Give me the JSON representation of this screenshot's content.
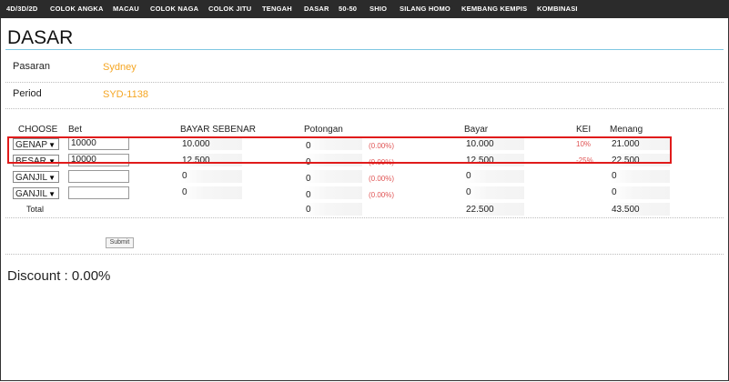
{
  "nav": [
    "4D/3D/2D",
    "COLOK ANGKA",
    "MACAU",
    "COLOK NAGA",
    "COLOK JITU",
    "TENGAH",
    "DASAR",
    "50-50",
    "SHIO",
    "SILANG HOMO",
    "KEMBANG KEMPIS",
    "KOMBINASI"
  ],
  "page": {
    "title": "DASAR"
  },
  "info": {
    "pasaran_label": "Pasaran",
    "pasaran_value": "Sydney",
    "period_label": "Period",
    "period_value": "SYD-1138"
  },
  "table": {
    "headers": {
      "choose": "CHOOSE",
      "bet": "Bet",
      "bayar_sebenar": "BAYAR SEBENAR",
      "potongan": "Potongan",
      "bayar": "Bayar",
      "kei": "KEI",
      "menang": "Menang"
    },
    "rows": [
      {
        "choose": "GENAP",
        "bet": "10000",
        "bayar_sebenar": "10.000",
        "potongan": "0",
        "potongan_pct": "(0.00%)",
        "bayar": "10.000",
        "kei": "10%",
        "menang": "21.000"
      },
      {
        "choose": "BESAR",
        "bet": "10000",
        "bayar_sebenar": "12.500",
        "potongan": "0",
        "potongan_pct": "(0.00%)",
        "bayar": "12.500",
        "kei": "-25%",
        "menang": "22.500"
      },
      {
        "choose": "GANJIL",
        "bet": "",
        "bayar_sebenar": "0",
        "potongan": "0",
        "potongan_pct": "(0.00%)",
        "bayar": "0",
        "kei": "",
        "menang": "0"
      },
      {
        "choose": "GANJIL",
        "bet": "",
        "bayar_sebenar": "0",
        "potongan": "0",
        "potongan_pct": "(0.00%)",
        "bayar": "0",
        "kei": "",
        "menang": "0"
      }
    ],
    "total": {
      "label": "Total",
      "potongan": "0",
      "bayar": "22.500",
      "menang": "43.500"
    }
  },
  "submit_label": "Submit",
  "discount": "Discount : 0.00%",
  "colors": {
    "nav_bg": "#2b2b2b",
    "accent_orange": "#f5a623",
    "title_rule": "#7fc8e2",
    "highlight": "#e01b1b",
    "pct_red": "#e05555"
  }
}
